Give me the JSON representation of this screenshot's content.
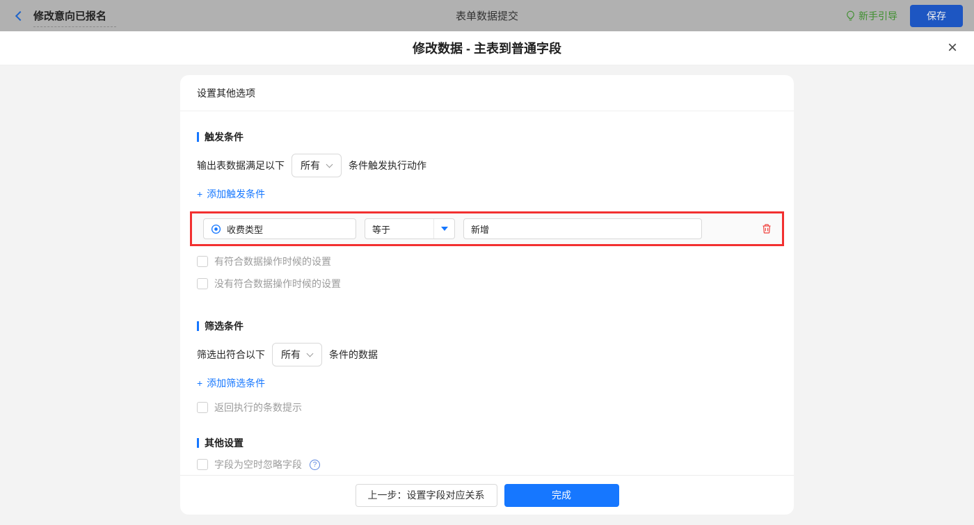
{
  "topbar": {
    "back_label": "修改意向已报名",
    "center_title": "表单数据提交",
    "guide_label": "新手引导",
    "save_label": "保存"
  },
  "dialog": {
    "title": "修改数据 - 主表到普通字段",
    "close_glyph": "×"
  },
  "panel": {
    "header": "设置其他选项",
    "trigger": {
      "title": "触发条件",
      "prefix": "输出表数据满足以下",
      "match_mode": "所有",
      "suffix": "条件触发执行动作",
      "add_plus": "+",
      "add_label": "添加触发条件",
      "condition": {
        "field": "收费类型",
        "operator": "等于",
        "value": "新增"
      },
      "checkbox_has_match": "有符合数据操作时候的设置",
      "checkbox_no_match": "没有符合数据操作时候的设置"
    },
    "filter": {
      "title": "筛选条件",
      "prefix": "筛选出符合以下",
      "match_mode": "所有",
      "suffix": "条件的数据",
      "add_plus": "+",
      "add_label": "添加筛选条件",
      "checkbox_count_tip": "返回执行的条数提示"
    },
    "other": {
      "title": "其他设置",
      "checkbox_ignore_empty": "字段为空时忽略字段",
      "help_glyph": "?"
    },
    "footer": {
      "prev_label": "上一步：设置字段对应关系",
      "done_label": "完成"
    }
  },
  "icons": {
    "back": "chevron-left",
    "guide": "lightbulb",
    "close": "x",
    "field_type": "radio-circle",
    "operator_caret": "caret-down",
    "select_arrow": "chevron-down",
    "delete": "trash",
    "help": "question-circle"
  },
  "colors": {
    "accent": "#1677ff",
    "highlight_border": "#f23030",
    "danger": "#f0413c",
    "guide_green": "#3f8f2f",
    "save_button": "#1d56c2",
    "topbar_bg": "#b1b1b1",
    "content_bg": "#f3f3f3"
  }
}
